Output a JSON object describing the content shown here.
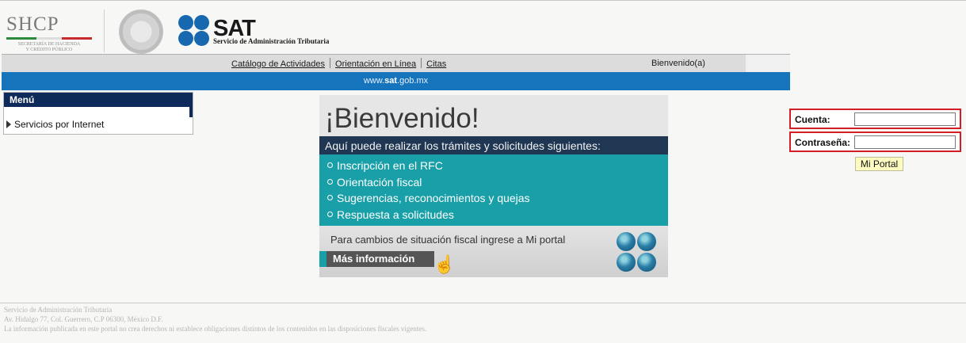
{
  "header": {
    "shcp_title": "SHCP",
    "shcp_subtitle_1": "SECRETARÍA DE HACIENDA",
    "shcp_subtitle_2": "Y CRÉDITO PÚBLICO",
    "sat_title": "SAT",
    "sat_subtitle": "Servicio de Administración Tributaria",
    "brand_blue": "#1768ae"
  },
  "nav": {
    "links": [
      "Catálogo de Actividades",
      "Orientación en Línea",
      "Citas"
    ],
    "welcome": "Bienvenido(a)"
  },
  "url_bar": {
    "prefix": "www.",
    "bold": "sat",
    "suffix": ".gob.mx",
    "color": "#1574bb"
  },
  "menu": {
    "title": "Menú",
    "items": [
      "Servicios por Internet"
    ]
  },
  "banner": {
    "title": "¡Bienvenido!",
    "subtitle": "Aquí puede realizar los trámites y solicitudes siguientes:",
    "items": [
      "Inscripción en el RFC",
      "Orientación fiscal",
      "Sugerencias, reconocimientos y quejas",
      "Respuesta a solicitudes"
    ],
    "note": "Para cambios de situación fiscal ingrese a Mi portal",
    "more_label": "Más información",
    "teal": "#199fa7",
    "dark": "#1f3753"
  },
  "login": {
    "account_label": "Cuenta:",
    "account_value": "",
    "password_label": "Contraseña:",
    "password_value": "",
    "submit_label": "Mi Portal",
    "highlight_color": "#d41e25"
  },
  "footer": {
    "line1": "Servicio de Administración Tributaria",
    "line2": "Av. Hidalgo 77, Col. Guerrero, C.P 06300, México D.F.",
    "line3": "La información publicada en este portal no crea derechos ni establece obligaciones distintos de los contenidos en las disposiciones fiscales vigentes."
  }
}
